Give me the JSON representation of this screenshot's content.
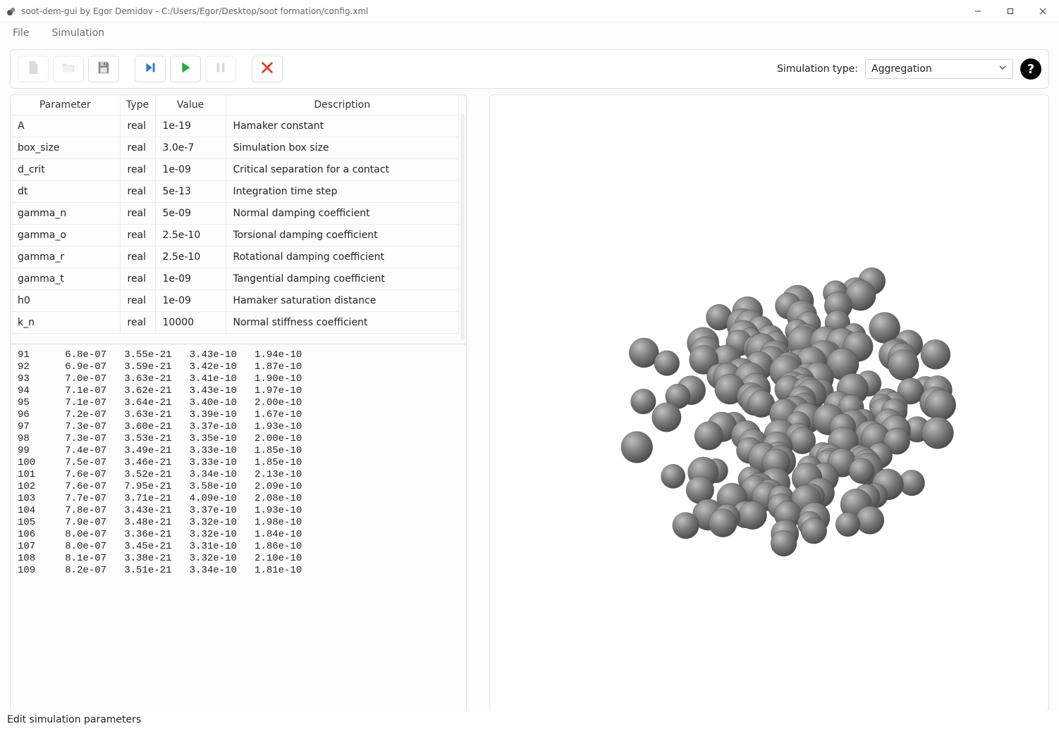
{
  "window": {
    "title": "soot-dem-gui by Egor Demidov - C:/Users/Egor/Desktop/soot formation/config.xml"
  },
  "menubar": {
    "file": "File",
    "simulation": "Simulation"
  },
  "toolbar": {
    "sim_type_label": "Simulation type:",
    "sim_type_value": "Aggregation"
  },
  "param_table": {
    "headers": {
      "param": "Parameter",
      "type": "Type",
      "value": "Value",
      "desc": "Description"
    },
    "rows": [
      {
        "param": "A",
        "type": "real",
        "value": "1e-19",
        "desc": "Hamaker constant"
      },
      {
        "param": "box_size",
        "type": "real",
        "value": "3.0e-7",
        "desc": "Simulation box size"
      },
      {
        "param": "d_crit",
        "type": "real",
        "value": "1e-09",
        "desc": "Critical separation for a contact"
      },
      {
        "param": "dt",
        "type": "real",
        "value": "5e-13",
        "desc": "Integration time step"
      },
      {
        "param": "gamma_n",
        "type": "real",
        "value": "5e-09",
        "desc": "Normal damping coefficient"
      },
      {
        "param": "gamma_o",
        "type": "real",
        "value": "2.5e-10",
        "desc": "Torsional damping coefficient"
      },
      {
        "param": "gamma_r",
        "type": "real",
        "value": "2.5e-10",
        "desc": "Rotational damping coefficient"
      },
      {
        "param": "gamma_t",
        "type": "real",
        "value": "1e-09",
        "desc": "Tangential damping coefficient"
      },
      {
        "param": "h0",
        "type": "real",
        "value": "1e-09",
        "desc": "Hamaker saturation distance"
      },
      {
        "param": "k_n",
        "type": "real",
        "value": "10000",
        "desc": "Normal stiffness coefficient"
      }
    ]
  },
  "log_rows": [
    {
      "n": "91",
      "c1": "6.8e-07",
      "c2": "3.55e-21",
      "c3": "3.43e-10",
      "c4": "1.94e-10"
    },
    {
      "n": "92",
      "c1": "6.9e-07",
      "c2": "3.59e-21",
      "c3": "3.42e-10",
      "c4": "1.87e-10"
    },
    {
      "n": "93",
      "c1": "7.0e-07",
      "c2": "3.63e-21",
      "c3": "3.41e-10",
      "c4": "1.90e-10"
    },
    {
      "n": "94",
      "c1": "7.1e-07",
      "c2": "3.62e-21",
      "c3": "3.43e-10",
      "c4": "1.97e-10"
    },
    {
      "n": "95",
      "c1": "7.1e-07",
      "c2": "3.64e-21",
      "c3": "3.40e-10",
      "c4": "2.00e-10"
    },
    {
      "n": "96",
      "c1": "7.2e-07",
      "c2": "3.63e-21",
      "c3": "3.39e-10",
      "c4": "1.67e-10"
    },
    {
      "n": "97",
      "c1": "7.3e-07",
      "c2": "3.60e-21",
      "c3": "3.37e-10",
      "c4": "1.93e-10"
    },
    {
      "n": "98",
      "c1": "7.3e-07",
      "c2": "3.53e-21",
      "c3": "3.35e-10",
      "c4": "2.00e-10"
    },
    {
      "n": "99",
      "c1": "7.4e-07",
      "c2": "3.49e-21",
      "c3": "3.33e-10",
      "c4": "1.85e-10"
    },
    {
      "n": "100",
      "c1": "7.5e-07",
      "c2": "3.46e-21",
      "c3": "3.33e-10",
      "c4": "1.85e-10"
    },
    {
      "n": "101",
      "c1": "7.6e-07",
      "c2": "3.52e-21",
      "c3": "3.34e-10",
      "c4": "2.13e-10"
    },
    {
      "n": "102",
      "c1": "7.6e-07",
      "c2": "7.95e-21",
      "c3": "3.58e-10",
      "c4": "2.09e-10"
    },
    {
      "n": "103",
      "c1": "7.7e-07",
      "c2": "3.71e-21",
      "c3": "4.09e-10",
      "c4": "2.08e-10"
    },
    {
      "n": "104",
      "c1": "7.8e-07",
      "c2": "3.43e-21",
      "c3": "3.37e-10",
      "c4": "1.93e-10"
    },
    {
      "n": "105",
      "c1": "7.9e-07",
      "c2": "3.48e-21",
      "c3": "3.32e-10",
      "c4": "1.98e-10"
    },
    {
      "n": "106",
      "c1": "8.0e-07",
      "c2": "3.36e-21",
      "c3": "3.32e-10",
      "c4": "1.84e-10"
    },
    {
      "n": "107",
      "c1": "8.0e-07",
      "c2": "3.45e-21",
      "c3": "3.31e-10",
      "c4": "1.86e-10"
    },
    {
      "n": "108",
      "c1": "8.1e-07",
      "c2": "3.38e-21",
      "c3": "3.32e-10",
      "c4": "2.10e-10"
    },
    {
      "n": "109",
      "c1": "8.2e-07",
      "c2": "3.51e-21",
      "c3": "3.34e-10",
      "c4": "1.81e-10"
    }
  ],
  "statusbar": {
    "text": "Edit simulation parameters"
  },
  "help_glyph": "?"
}
